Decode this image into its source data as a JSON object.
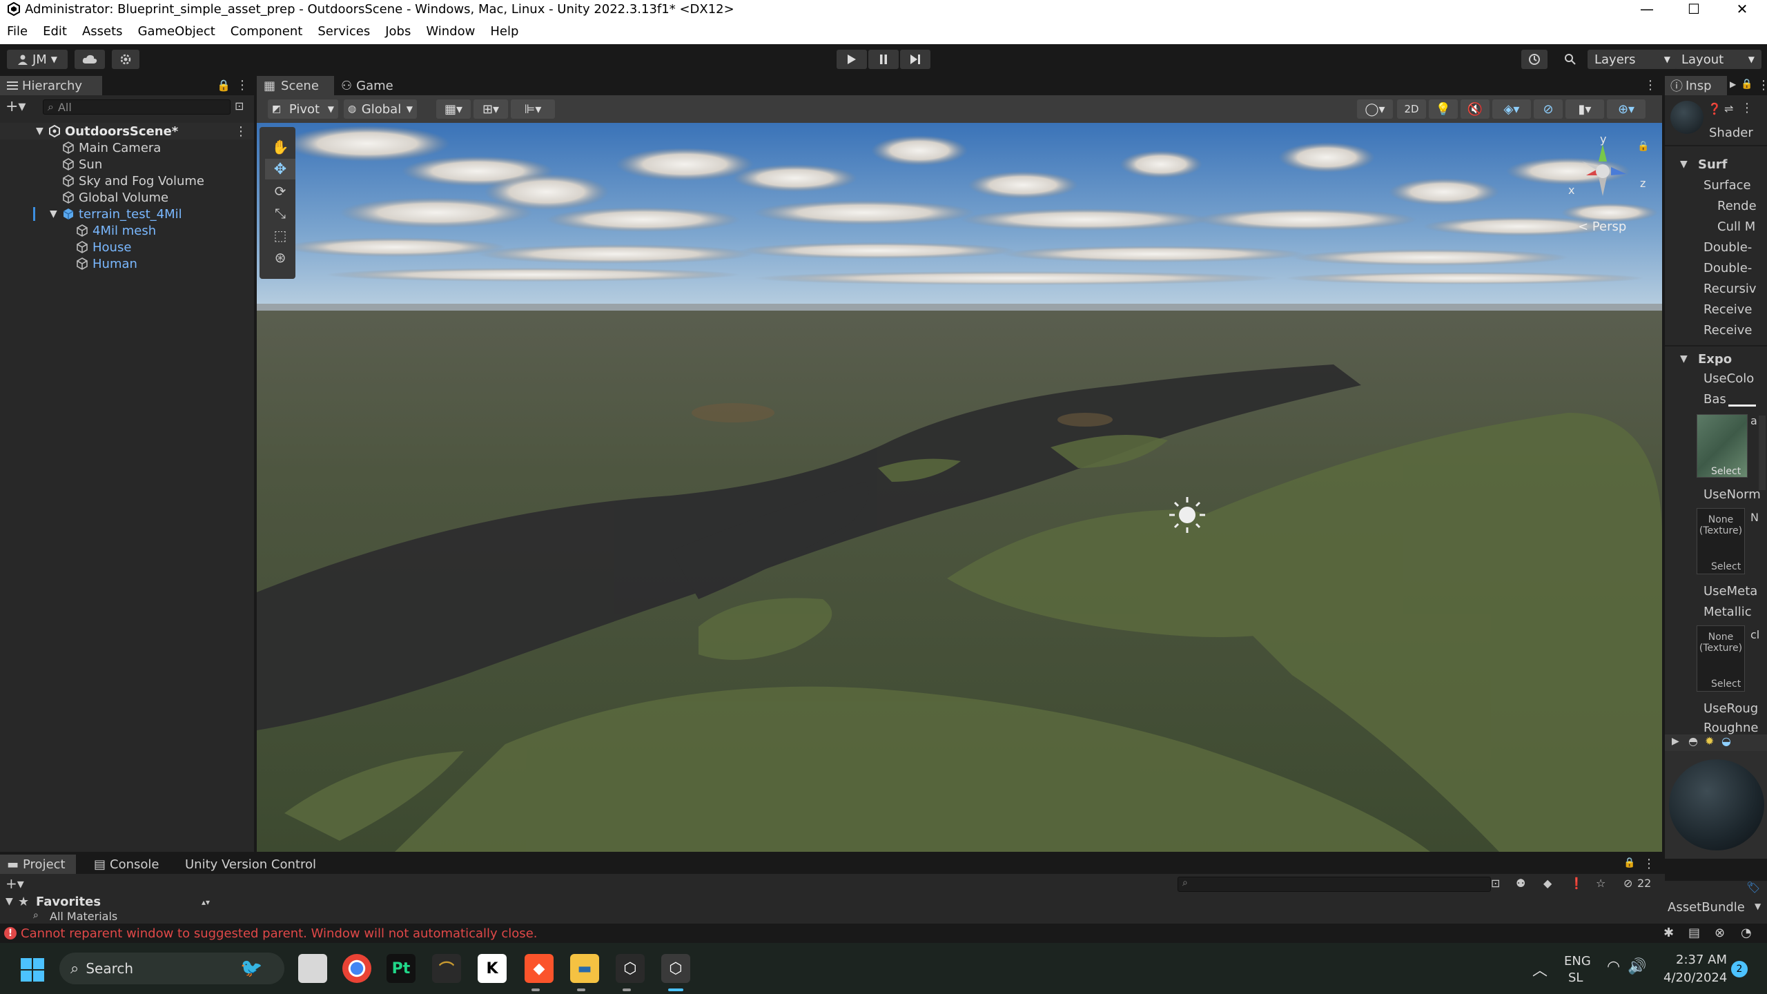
{
  "window": {
    "title": "Administrator: Blueprint_simple_asset_prep - OutdoorsScene - Windows, Mac, Linux - Unity 2022.3.13f1* <DX12>",
    "minimize": "—",
    "maximize": "☐",
    "close": "✕"
  },
  "menu": [
    "File",
    "Edit",
    "Assets",
    "GameObject",
    "Component",
    "Services",
    "Jobs",
    "Window",
    "Help"
  ],
  "toolbar": {
    "account": "JM",
    "layers": "Layers",
    "layout": "Layout"
  },
  "hierarchy": {
    "tab": "Hierarchy",
    "search_placeholder": "All",
    "scene": "OutdoorsScene*",
    "items": [
      {
        "label": "Main Camera"
      },
      {
        "label": "Sun"
      },
      {
        "label": "Sky and Fog Volume"
      },
      {
        "label": "Global Volume"
      },
      {
        "label": "terrain_test_4Mil"
      },
      {
        "label": "4Mil mesh"
      },
      {
        "label": "House"
      },
      {
        "label": "Human"
      }
    ]
  },
  "scene": {
    "tabs": [
      "Scene",
      "Game"
    ],
    "pivot": "Pivot",
    "global": "Global",
    "mode_2d": "2D",
    "persp": "< Persp",
    "axis_y": "y",
    "axis_x": "x",
    "axis_z": "z"
  },
  "inspector": {
    "tab": "Insp",
    "shader": "Shader",
    "section_surface": "Surf",
    "section_exposed": "Expo",
    "labels": [
      "Surface",
      "Rende",
      "Cull M",
      "Double-",
      "Double-",
      "Recursiv",
      "Receive",
      "Receive"
    ],
    "exposed_labels": [
      "UseColo",
      "Bas"
    ],
    "use_normal": "UseNorm",
    "use_metal": "UseMeta",
    "metallic": "Metallic",
    "use_rough": "UseRoug",
    "roughness": "Roughne",
    "none_texture": "None (Texture)",
    "select": "Select",
    "asset_bundle": "AssetBundle",
    "side_a": "a",
    "side_n": "N",
    "side_cl": "cl"
  },
  "bottom": {
    "tabs": [
      "Project",
      "Console",
      "Unity Version Control"
    ],
    "favorites": "Favorites",
    "all_materials": "All Materials",
    "hidden_count": "22"
  },
  "status": {
    "message": "Cannot reparent window to suggested parent. Window will not automatically close."
  },
  "taskbar": {
    "search": "Search",
    "lang1": "ENG",
    "lang2": "SL",
    "time": "2:37 AM",
    "date": "4/20/2024",
    "notif": "2",
    "pt_label": "Pt",
    "k_label": "K"
  },
  "colors": {
    "accent": "#3d8fe0",
    "error": "#e04848",
    "panel": "#282828"
  }
}
